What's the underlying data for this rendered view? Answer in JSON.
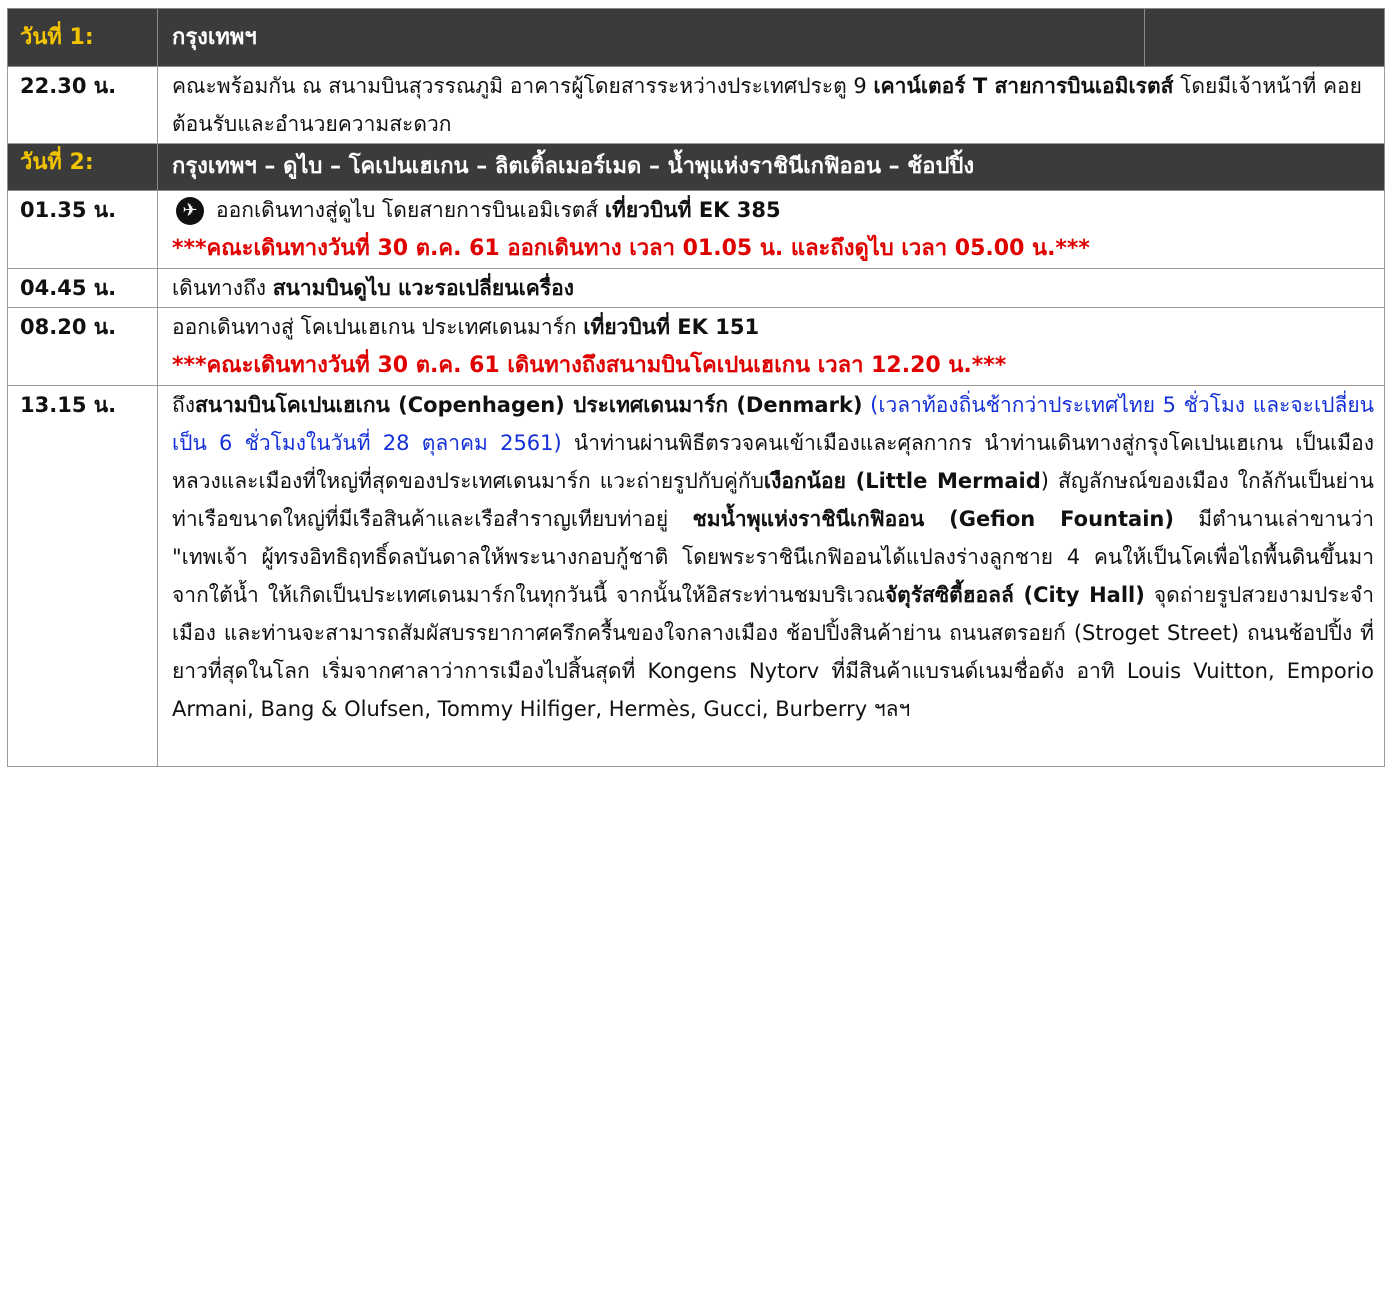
{
  "day1": {
    "label": "วันที่ 1:",
    "title": "กรุงเทพฯ",
    "rows": [
      {
        "time": "22.30 น.",
        "text_a": "คณะพร้อมกัน ณ สนามบินสุวรรณภูมิ อาคารผู้โดยสารระหว่างประเทศประตู 9 ",
        "text_b": "เคาน์เตอร์ T สายการบินเอมิเรตส์",
        "text_c": " โดยมีเจ้าหน้าที่ คอยต้อนรับและอำนวยความสะดวก"
      }
    ]
  },
  "day2": {
    "label": "วันที่ 2:",
    "title": "กรุงเทพฯ – ดูไบ – โคเปนเฮเกน –  ลิตเติ้ลเมอร์เมด – น้ำพุแห่งราชินีเกฟิออน – ช้อปปิ้ง",
    "rows": [
      {
        "time": "01.35 น.",
        "icon": "plane-icon",
        "text_a": "ออกเดินทางสู่ดูไบ โดยสายการบินเอมิเรตส์ ",
        "text_b": "เที่ยวบินที่ EK 385",
        "note": "***คณะเดินทางวันที่ 30 ต.ค. 61 ออกเดินทาง เวลา 01.05 น. และถึงดูไบ เวลา 05.00 น.***"
      },
      {
        "time": "04.45 น.",
        "text_a": "เดินทางถึง ",
        "text_b": "สนามบินดูไบ แวะรอเปลี่ยนเครื่อง"
      },
      {
        "time": "08.20 น.",
        "text_a": " ออกเดินทางสู่ โคเปนเฮเกน ประเทศเดนมาร์ก ",
        "text_b": "เที่ยวบินที่ EK 151",
        "note": "***คณะเดินทางวันที่ 30 ต.ค. 61 เดินทางถึงสนามบินโคเปนเฮเกน เวลา 12.20 น.***"
      },
      {
        "time": "13.15 น.",
        "p1": "ถึง",
        "p2": "สนามบินโคเปนเฮเกน (Copenhagen) ประเทศเดนมาร์ก (Denmark)",
        "p3": " (เวลาท้องถิ่นช้ากว่าประเทศไทย 5 ชั่วโมง และจะเปลี่ยนเป็น 6 ชั่วโมงในวันที่ 28 ตุลาคม 2561)",
        "p4": " นำท่านผ่านพิธีตรวจคนเข้าเมืองและศุลกากร นำท่านเดินทางสู่กรุงโคเปนเฮเกน เป็นเมืองหลวงและเมืองที่ใหญ่ที่สุดของประเทศเดนมาร์ก  แวะถ่ายรูปกับคู่กับ",
        "p5": "เงือกน้อย (Little Mermaid",
        "p6": ") สัญลักษณ์ของเมือง ใกล้กันเป็นย่านท่าเรือขนาดใหญ่ที่มีเรือสินค้าและเรือสำราญเทียบท่าอยู่ ",
        "p7": "ชมน้ำพุแห่งราชินีเกฟิออน (Gefion Fountain)",
        "p8": "   มีตำนานเล่าขานว่า \"เทพเจ้า ผู้ทรงอิทธิฤทธิ์ดลบันดาลให้พระนางกอบกู้ชาติ โดยพระราชินีเกฟิออนได้แปลงร่างลูกชาย 4 คนให้เป็นโคเพื่อไถพื้นดินขึ้นมาจากใต้น้ำ ให้เกิดเป็นประเทศเดนมาร์กในทุกวันนี้   จากนั้นให้อิสระท่านชมบริเวณ",
        "p9": "จัตุรัสซิตี้ฮอลล์ (City Hall)",
        "p10": " จุดถ่ายรูปสวยงามประจำเมือง และท่านจะสามารถสัมผัสบรรยากาศครึกครื้นของใจกลางเมือง ช้อปปิ้งสินค้าย่าน ถนนสตรอยก์ (Stroget Street) ถนนช้อปปิ้ง ที่ยาวที่สุดในโลก เริ่มจากศาลาว่าการเมืองไปสิ้นสุดที่ Kongens Nytorv ที่มีสินค้าแบรนด์เนมชื่อดัง อาทิ Louis Vuitton, Emporio Armani, Bang & Olufsen, Tommy Hilfiger, Hermès, Gucci, Burberry ฯลฯ"
      }
    ]
  },
  "colors": {
    "header_bg": "#3b3b3b",
    "day_label": "#f3c400",
    "note_red": "#e00000",
    "note_blue": "#1430d8"
  }
}
